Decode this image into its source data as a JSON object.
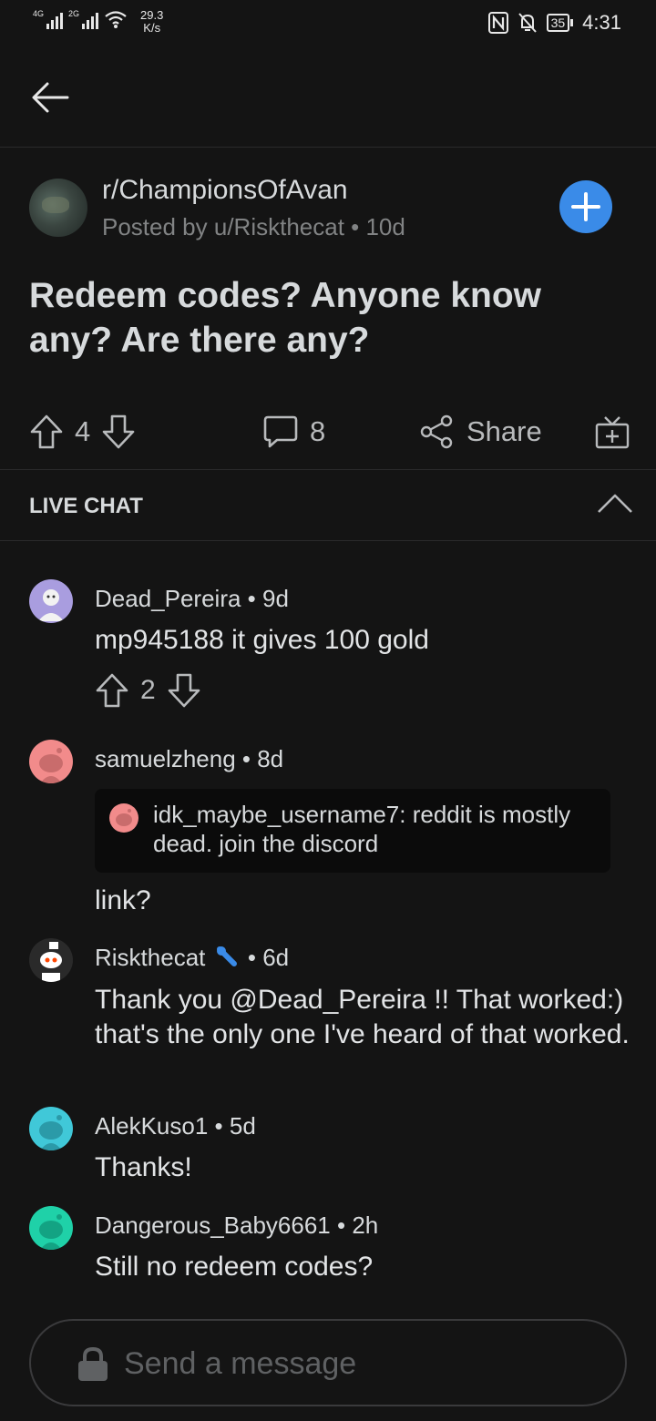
{
  "status_bar": {
    "net1": "4G",
    "net2": "2G",
    "speed_value": "29.3",
    "speed_unit": "K/s",
    "battery": "35",
    "time": "4:31"
  },
  "post": {
    "subreddit": "r/ChampionsOfAvan",
    "posted_by": "Posted by u/Riskthecat • 10d",
    "title": "Redeem codes? Anyone know any? Are there any?",
    "score": "4",
    "comments": "8",
    "share_label": "Share"
  },
  "live_chat": {
    "label": "LIVE CHAT"
  },
  "comments": [
    {
      "user": "Dead_Pereira",
      "time": "9d",
      "body": "mp945188  it gives 100 gold",
      "score": "2",
      "avatar_color": "#a99ddf"
    },
    {
      "user": "samuelzheng",
      "time": "8d",
      "body": "link?",
      "avatar_color": "#f28b8b",
      "quote_user": "idk_maybe_username7",
      "quote_text": ": reddit is mostly dead. join the discord"
    },
    {
      "user": "Riskthecat",
      "time": "6d",
      "body": "Thank you @Dead_Pereira !! That worked:) that's the only one I've heard of that worked.",
      "avatar_color": "#222222"
    },
    {
      "user": "AlekKuso1",
      "time": "5d",
      "body": "Thanks!",
      "avatar_color": "#40c8d8"
    },
    {
      "user": "Dangerous_Baby6661",
      "time": "2h",
      "body": "Still no redeem codes?",
      "avatar_color": "#1fd1a8"
    }
  ],
  "composer": {
    "placeholder": "Send a message"
  },
  "colors": {
    "accent": "#3a8be8",
    "background": "#141414",
    "mod_badge": "#3a8be8"
  }
}
